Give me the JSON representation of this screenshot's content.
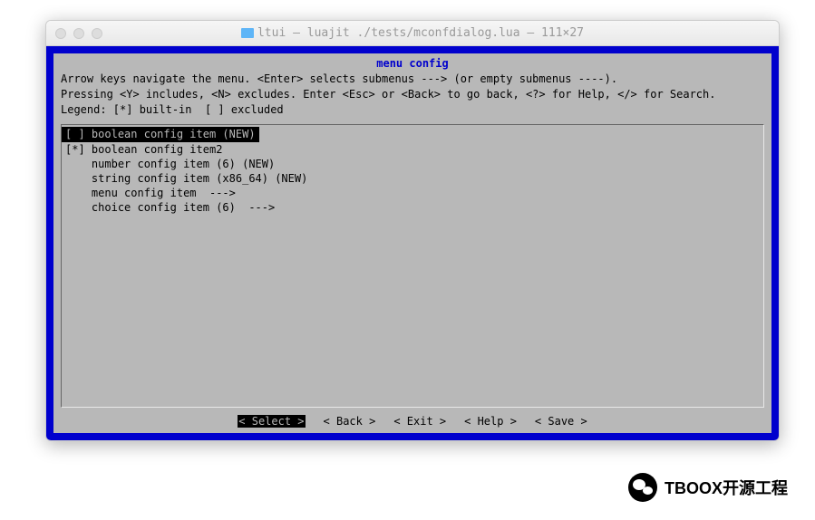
{
  "window": {
    "title": "ltui — luajit ./tests/mconfdialog.lua — 111×27"
  },
  "dialog": {
    "title": "menu config",
    "help_text": "Arrow keys navigate the menu. <Enter> selects submenus ---> (or empty submenus ----).\nPressing <Y> includes, <N> excludes. Enter <Esc> or <Back> to go back, <?> for Help, </> for Search. Legend: [*] built-in  [ ] excluded"
  },
  "menu_items": [
    {
      "prefix": "[ ]",
      "label": "boolean config item (NEW)",
      "selected": true
    },
    {
      "prefix": "[*]",
      "label": "boolean config item2",
      "selected": false
    },
    {
      "prefix": "   ",
      "label": "number config item (6) (NEW)",
      "selected": false
    },
    {
      "prefix": "   ",
      "label": "string config item (x86_64) (NEW)",
      "selected": false
    },
    {
      "prefix": "   ",
      "label": "menu config item  --->",
      "selected": false
    },
    {
      "prefix": "   ",
      "label": "choice config item (6)  --->",
      "selected": false
    }
  ],
  "buttons": [
    {
      "label": "< Select >",
      "active": true
    },
    {
      "label": "< Back >",
      "active": false
    },
    {
      "label": "< Exit >",
      "active": false
    },
    {
      "label": "< Help >",
      "active": false
    },
    {
      "label": "< Save >",
      "active": false
    }
  ],
  "watermark": {
    "text": "TBOOX开源工程"
  }
}
